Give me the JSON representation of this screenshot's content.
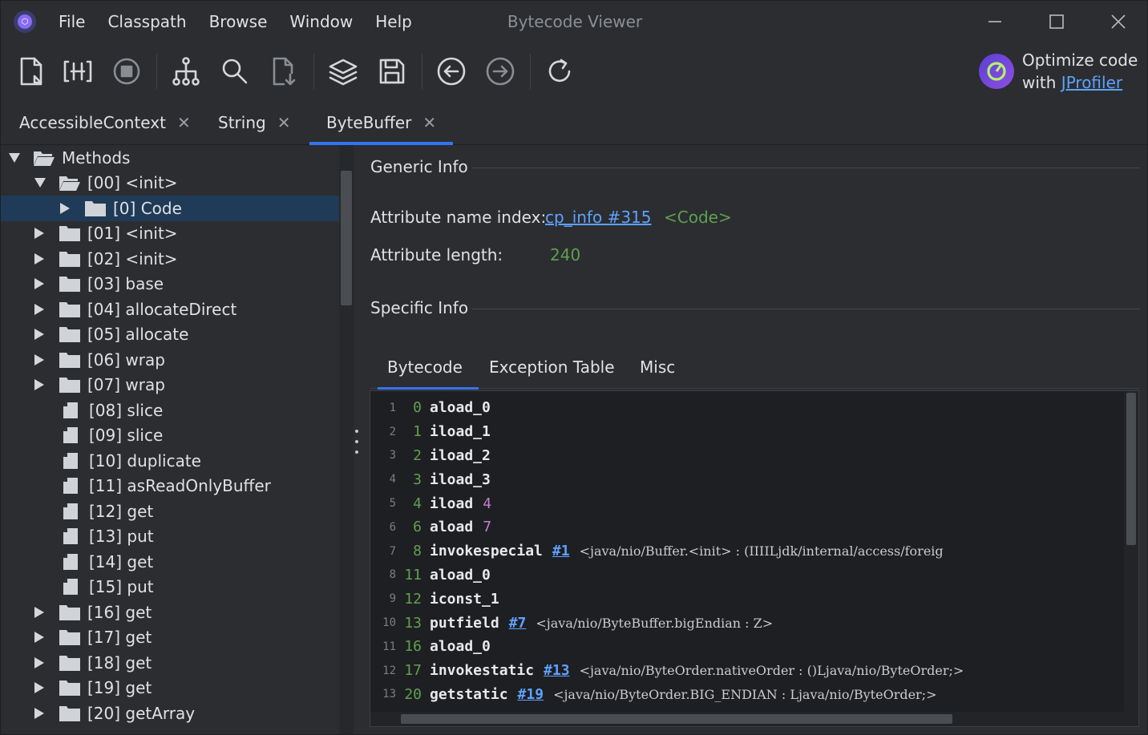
{
  "window": {
    "title": "Bytecode Viewer"
  },
  "menu": [
    "File",
    "Classpath",
    "Browse",
    "Window",
    "Help"
  ],
  "toolbar": {
    "buttons": [
      "open-file-icon",
      "decompile-icon",
      "stop-icon",
      "hierarchy-icon",
      "search-icon",
      "download-file-icon",
      "layers-icon",
      "save-icon",
      "back-icon",
      "forward-icon",
      "refresh-icon"
    ]
  },
  "promo": {
    "line1": "Optimize code",
    "line2_prefix": "with",
    "link": "JProfiler"
  },
  "tabs": [
    {
      "label": "AccessibleContext",
      "close": "✕"
    },
    {
      "label": "String",
      "close": "✕"
    },
    {
      "label": "ByteBuffer",
      "close": "✕"
    }
  ],
  "tree": [
    {
      "label": "Methods"
    },
    {
      "label": "[00] <init>"
    },
    {
      "label": "[0] Code"
    },
    {
      "label": "[01] <init>"
    },
    {
      "label": "[02] <init>"
    },
    {
      "label": "[03] base"
    },
    {
      "label": "[04] allocateDirect"
    },
    {
      "label": "[05] allocate"
    },
    {
      "label": "[06] wrap"
    },
    {
      "label": "[07] wrap"
    },
    {
      "label": "[08] slice"
    },
    {
      "label": "[09] slice"
    },
    {
      "label": "[10] duplicate"
    },
    {
      "label": "[11] asReadOnlyBuffer"
    },
    {
      "label": "[12] get"
    },
    {
      "label": "[13] put"
    },
    {
      "label": "[14] get"
    },
    {
      "label": "[15] put"
    },
    {
      "label": "[16] get"
    },
    {
      "label": "[17] get"
    },
    {
      "label": "[18] get"
    },
    {
      "label": "[19] get"
    },
    {
      "label": "[20] getArray"
    }
  ],
  "generic": {
    "title": "Generic Info",
    "name_index_label": "Attribute name index:",
    "name_index_link": "cp_info #315",
    "name_index_value": "<Code>",
    "length_label": "Attribute length:",
    "length_value": "240"
  },
  "specific": {
    "title": "Specific Info"
  },
  "subtabs": [
    "Bytecode",
    "Exception Table",
    "Misc"
  ],
  "code": [
    {
      "ln": "1",
      "off": "0",
      "op": "aload_0",
      "arg": "",
      "desc": ""
    },
    {
      "ln": "2",
      "off": "1",
      "op": "iload_1",
      "arg": "",
      "desc": ""
    },
    {
      "ln": "3",
      "off": "2",
      "op": "iload_2",
      "arg": "",
      "desc": ""
    },
    {
      "ln": "4",
      "off": "3",
      "op": "iload_3",
      "arg": "",
      "desc": ""
    },
    {
      "ln": "5",
      "off": "4",
      "op": "iload",
      "arg": "4",
      "desc": ""
    },
    {
      "ln": "6",
      "off": "6",
      "op": "aload",
      "arg": "7",
      "desc": ""
    },
    {
      "ln": "7",
      "off": "8",
      "op": "invokespecial",
      "arg": "#1",
      "desc": "<java/nio/Buffer.<init> : (IIIILjdk/internal/access/foreig"
    },
    {
      "ln": "8",
      "off": "11",
      "op": "aload_0",
      "arg": "",
      "desc": ""
    },
    {
      "ln": "9",
      "off": "12",
      "op": "iconst_1",
      "arg": "",
      "desc": ""
    },
    {
      "ln": "10",
      "off": "13",
      "op": "putfield",
      "arg": "#7",
      "desc": "<java/nio/ByteBuffer.bigEndian : Z>"
    },
    {
      "ln": "11",
      "off": "16",
      "op": "aload_0",
      "arg": "",
      "desc": ""
    },
    {
      "ln": "12",
      "off": "17",
      "op": "invokestatic",
      "arg": "#13",
      "desc": "<java/nio/ByteOrder.nativeOrder : ()Ljava/nio/ByteOrder;>"
    },
    {
      "ln": "13",
      "off": "20",
      "op": "getstatic",
      "arg": "#19",
      "desc": "<java/nio/ByteOrder.BIG_ENDIAN : Ljava/nio/ByteOrder;>"
    }
  ]
}
